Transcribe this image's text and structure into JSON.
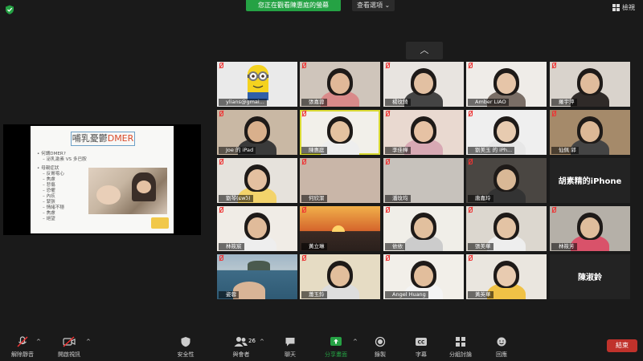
{
  "top": {
    "banner": "您正在觀看陳惠庭的螢幕",
    "view_options": "查看選項 ⌄",
    "view": "檢視"
  },
  "slide": {
    "title_prefix": "哺乳憂鬱",
    "title_accent": "DMER",
    "bullets": [
      {
        "t": "• 何謂DMER?",
        "c": "b"
      },
      {
        "t": "– 泌乳激素 VS 多巴胺",
        "c": "s"
      },
      {
        "t": "",
        "c": "s"
      },
      {
        "t": "• 母親症狀",
        "c": "b"
      },
      {
        "t": "– 反胃噁心",
        "c": "s"
      },
      {
        "t": "– 焦慮",
        "c": "s"
      },
      {
        "t": "– 悲傷",
        "c": "s"
      },
      {
        "t": "– 恐懼",
        "c": "s"
      },
      {
        "t": "– 內疚",
        "c": "s"
      },
      {
        "t": "– 緊張",
        "c": "s"
      },
      {
        "t": "– 情緒不穩",
        "c": "s"
      },
      {
        "t": "– 焦慮",
        "c": "s"
      },
      {
        "t": "– 絕望",
        "c": "s"
      }
    ]
  },
  "participants": [
    "ylians@gmai...",
    "張嘉蓉",
    "",
    "楊玟錡",
    "Amber LIAO",
    "羅宇萍",
    "Joe 的 iPad",
    "陳惠庭",
    "李佳樺",
    "劉美玉 的 iPh...",
    "仙佩 郭",
    "劉琴(ɕwɔ̃)",
    "何欣潔",
    "潘玟均",
    "唐嘉玲",
    "胡素精的iPhone",
    "林筱宸",
    "黃立琳",
    "依依",
    "張美華",
    "林筱芳",
    "姿蓉",
    "蕭玉鈴",
    "Angel Huang",
    "黃英華",
    "陳淑鈴"
  ],
  "toolbar": {
    "unmute": "解除靜音",
    "start_video": "開啟視訊",
    "security": "安全性",
    "participants": "與會者",
    "participants_count": "26",
    "chat": "聊天",
    "share": "分享畫面",
    "record": "錄製",
    "captions": "字幕",
    "breakout": "分組討論",
    "reactions": "回應",
    "end": "結束"
  },
  "colors": {
    "share_green": "#25a244",
    "end_red": "#c0322b",
    "active_speaker": "#d9d933",
    "muted_red": "#e33"
  }
}
